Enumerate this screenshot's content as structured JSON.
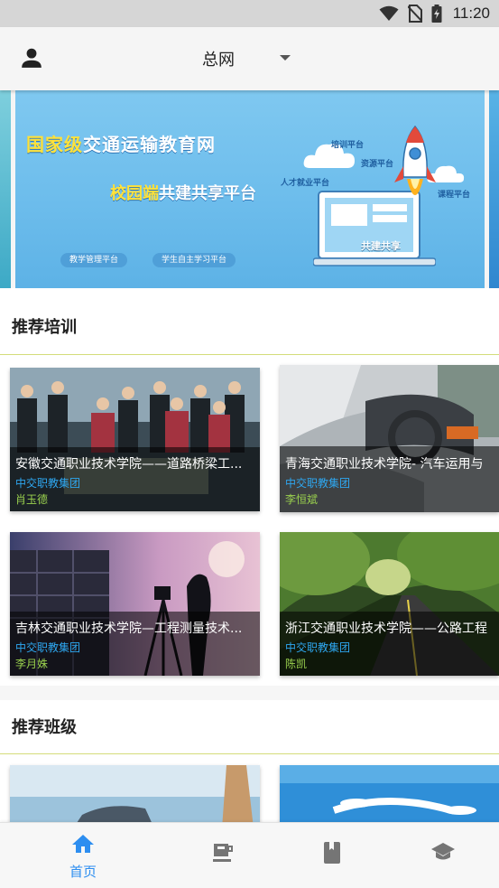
{
  "status_bar": {
    "time": "11:20"
  },
  "header": {
    "title": "总网"
  },
  "banner": {
    "title_highlight": "国家级",
    "title_rest": "交通运输教育网",
    "subtitle_highlight": "校园端",
    "subtitle_rest": "共建共享平台",
    "tags": [
      "培训平台",
      "资源平台",
      "人才就业平台",
      "课程平台"
    ],
    "pills": [
      "教学管理平台",
      "学生自主学习平台"
    ],
    "screen_text": "共建共享"
  },
  "sections": {
    "training_title": "推荐培训",
    "class_title": "推荐班级"
  },
  "training_cards": [
    {
      "title": "安徽交通职业技术学院——道路桥梁工...",
      "org": "中交职教集团",
      "teacher": "肖玉德"
    },
    {
      "title": "青海交通职业技术学院- 汽车运用与",
      "org": "中交职教集团",
      "teacher": "李恒斌"
    },
    {
      "title": "吉林交通职业技术学院—工程测量技术...",
      "org": "中交职教集团",
      "teacher": "李月姝"
    },
    {
      "title": "浙江交通职业技术学院——公路工程",
      "org": "中交职教集团",
      "teacher": "陈凯"
    }
  ],
  "bottom_nav": {
    "items": [
      {
        "label": "首页",
        "icon": "home-icon",
        "active": true
      },
      {
        "label": "",
        "icon": "coffee-cup-icon",
        "active": false
      },
      {
        "label": "",
        "icon": "book-icon",
        "active": false
      },
      {
        "label": "",
        "icon": "graduation-cap-icon",
        "active": false
      }
    ],
    "active_color": "#2d8ef0",
    "inactive_color": "#757575"
  }
}
